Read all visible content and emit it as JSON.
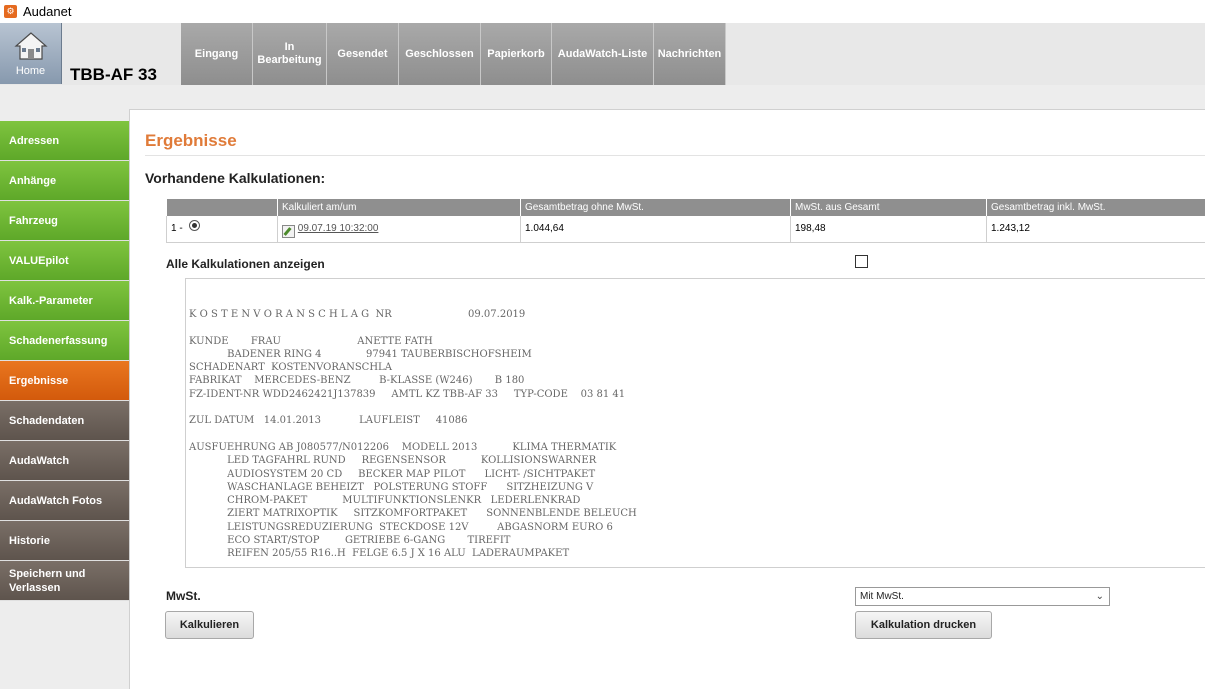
{
  "window": {
    "title": "Audanet",
    "icon": "audanet-app-icon"
  },
  "header": {
    "home_label": "Home",
    "home_icon": "house-icon",
    "case_title": "TBB-AF 33",
    "tabs": [
      {
        "label": "Eingang"
      },
      {
        "label": "In Bearbeitung"
      },
      {
        "label": "Gesendet"
      },
      {
        "label": "Geschlossen"
      },
      {
        "label": "Papierkorb"
      },
      {
        "label": "AudaWatch-Liste"
      },
      {
        "label": "Nachrichten"
      }
    ]
  },
  "sidebar": {
    "items": [
      {
        "label": "Adressen",
        "state": "green"
      },
      {
        "label": "Anhänge",
        "state": "green"
      },
      {
        "label": "Fahrzeug",
        "state": "green"
      },
      {
        "label": "VALUEpilot",
        "state": "green"
      },
      {
        "label": "Kalk.-Parameter",
        "state": "green"
      },
      {
        "label": "Schadenerfassung",
        "state": "green"
      },
      {
        "label": "Ergebnisse",
        "state": "active"
      },
      {
        "label": "Schadendaten",
        "state": "brown"
      },
      {
        "label": "AudaWatch",
        "state": "brown"
      },
      {
        "label": "AudaWatch Fotos",
        "state": "brown"
      },
      {
        "label": "Historie",
        "state": "brown"
      },
      {
        "label": "Speichern und Verlassen",
        "state": "brown"
      }
    ]
  },
  "main": {
    "title": "Ergebnisse",
    "section_title": "Vorhandene Kalkulationen:",
    "table": {
      "columns": [
        "",
        "Kalkuliert am/um",
        "Gesamtbetrag ohne MwSt.",
        "MwSt. aus Gesamt",
        "Gesamtbetrag inkl. MwSt."
      ],
      "rows": [
        {
          "index": "1 -",
          "selected": true,
          "date": "09.07.19 10:32:00",
          "net": "1.044,64",
          "vat": "198,48",
          "gross": "1.243,12"
        }
      ]
    },
    "show_all_label": "Alle Kalkulationen anzeigen",
    "show_all_checked": false,
    "document_text": "K O S T E N V O R A N S C H L A G  NR                        09.07.2019\n\nKUNDE       FRAU                        ANETTE FATH\n            BADENER RING 4              97941 TAUBERBISCHOFSHEIM\nSCHADENART  KOSTENVORANSCHLA\nFABRIKAT    MERCEDES-BENZ         B-KLASSE (W246)       B 180\nFZ-IDENT-NR WDD2462421J137839     AMTL KZ TBB-AF 33     TYP-CODE    03 81 41\n\nZUL DATUM   14.01.2013            LAUFLEIST     41086\n\nAUSFUEHRUNG AB J080577/N012206    MODELL 2013           KLIMA THERMATIK\n            LED TAGFAHRL RUND     REGENSENSOR           KOLLISIONSWARNER\n            AUDIOSYSTEM 20 CD     BECKER MAP PILOT      LICHT- /SICHTPAKET\n            WASCHANLAGE BEHEIZT   POLSTERUNG STOFF      SITZHEIZUNG V\n            CHROM-PAKET           MULTIFUNKTIONSLENKR   LEDERLENKRAD\n            ZIERT MATRIXOPTIK     SITZKOMFORTPAKET      SONNENBLENDE BELEUCH\n            LEISTUNGSREDUZIERUNG  STECKDOSE 12V         ABGASNORM EURO 6\n            ECO START/STOP        GETRIEBE 6-GANG       TIREFIT\n            REIFEN 205/55 R16..H  FELGE 6.5 J X 16 ALU  LADERAUMPAKET",
    "mwst_label": "MwSt.",
    "mwst_selected": "Mit MwSt.",
    "buttons": {
      "calculate": "Kalkulieren",
      "print": "Kalkulation drucken"
    }
  }
}
